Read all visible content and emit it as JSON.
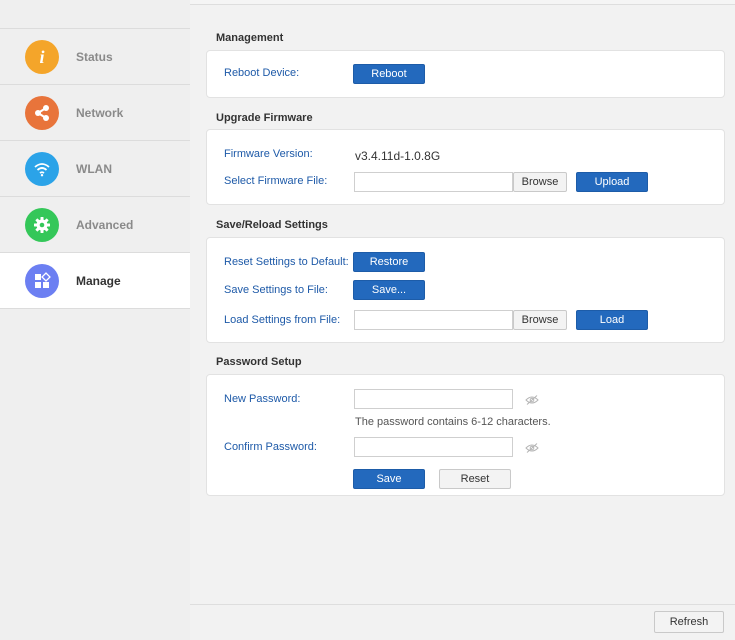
{
  "sidebar": {
    "items": [
      {
        "label": "Status",
        "icon": "info-icon",
        "color": "#f4a52a"
      },
      {
        "label": "Network",
        "icon": "share-icon",
        "color": "#e8743b"
      },
      {
        "label": "WLAN",
        "icon": "wifi-icon",
        "color": "#2ba3e8"
      },
      {
        "label": "Advanced",
        "icon": "gear-icon",
        "color": "#34c759"
      },
      {
        "label": "Manage",
        "icon": "apps-icon",
        "color": "#6c7ff2"
      }
    ],
    "active": "Manage"
  },
  "management": {
    "title": "Management",
    "reboot_label": "Reboot Device:",
    "reboot_button": "Reboot"
  },
  "firmware": {
    "title": "Upgrade Firmware",
    "version_label": "Firmware Version:",
    "version_value": "v3.4.11d-1.0.8G",
    "file_label": "Select Firmware File:",
    "browse_button": "Browse",
    "upload_button": "Upload"
  },
  "settings": {
    "title": "Save/Reload Settings",
    "reset_label": "Reset Settings to Default:",
    "restore_button": "Restore",
    "save_label": "Save Settings to File:",
    "save_button": "Save...",
    "load_label": "Load Settings from File:",
    "browse_button": "Browse",
    "load_button": "Load"
  },
  "password": {
    "title": "Password Setup",
    "new_label": "New Password:",
    "hint": "The password contains 6-12 characters.",
    "confirm_label": "Confirm Password:",
    "save_button": "Save",
    "reset_button": "Reset"
  },
  "footer": {
    "refresh_button": "Refresh"
  },
  "colors": {
    "primary": "#2369bd",
    "label": "#1e5aa8"
  }
}
